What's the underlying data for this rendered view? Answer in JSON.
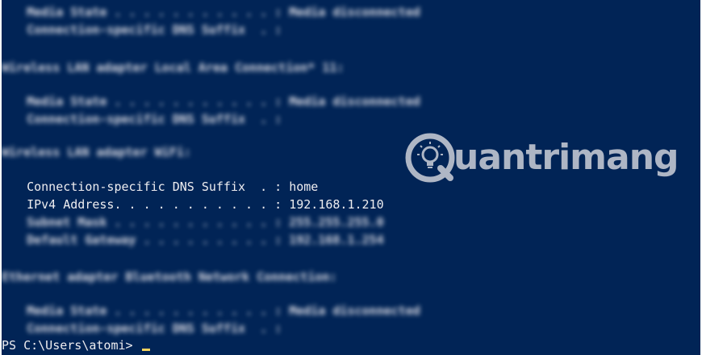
{
  "terminal": {
    "background": "#012456",
    "blurred_lines": {
      "l1": "   Media State . . . . . . . . . . . : Media disconnected",
      "l2": "   Connection-specific DNS Suffix  . :",
      "l3": "Wireless LAN adapter Local Area Connection* 11:",
      "l4": "   Media State . . . . . . . . . . . : Media disconnected",
      "l5": "   Connection-specific DNS Suffix  . :",
      "l6": "Wireless LAN adapter WiFi:",
      "l9": "   Subnet Mask . . . . . . . . . . . : 255.255.255.0",
      "l10": "   Default Gateway . . . . . . . . . : 192.168.1.254",
      "l11": "Ethernet adapter Bluetooth Network Connection:",
      "l12": "   Media State . . . . . . . . . . . : Media disconnected",
      "l13": "   Connection-specific DNS Suffix  . :"
    },
    "visible_lines": {
      "dns_suffix": "   Connection-specific DNS Suffix  . : home",
      "ipv4": "   IPv4 Address. . . . . . . . . . . : 192.168.1.210"
    },
    "prompt": "PS C:\\Users\\atomi> "
  },
  "watermark": {
    "text": "uantrimang",
    "icon": "lightbulb-q-icon"
  }
}
